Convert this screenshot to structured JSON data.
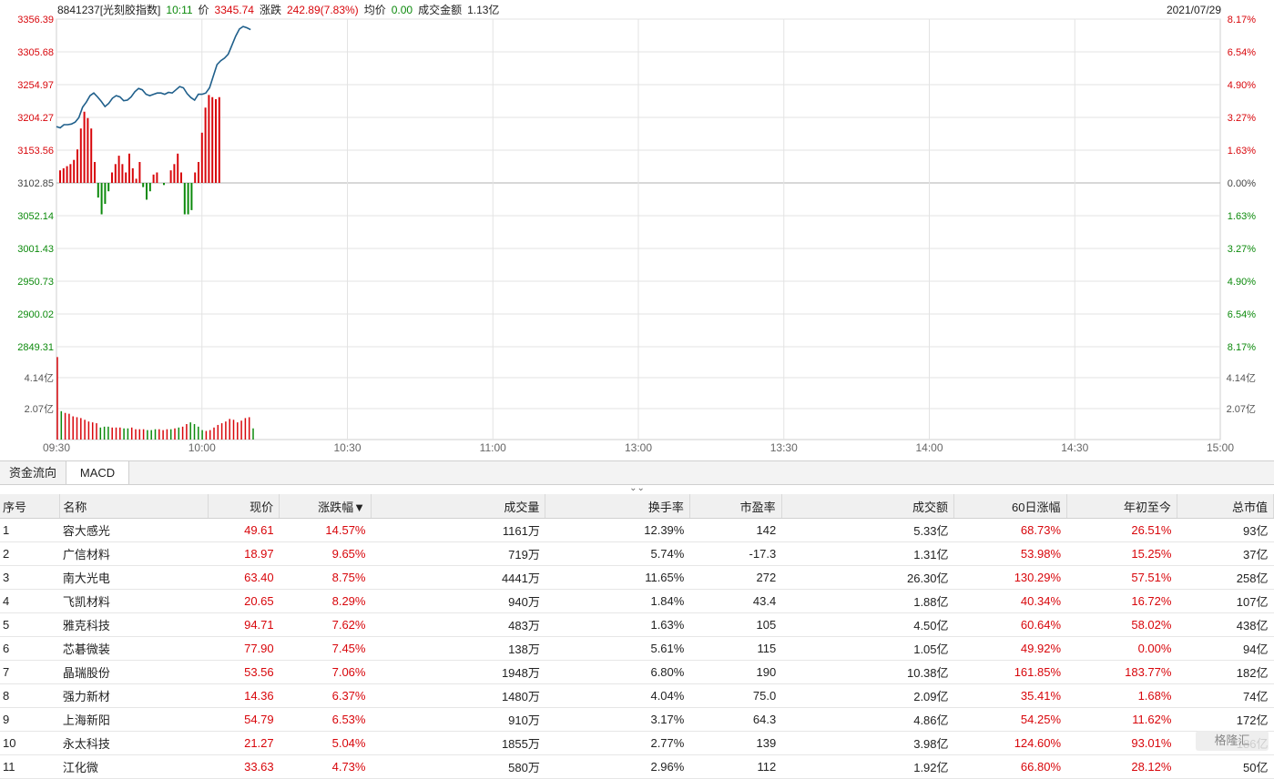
{
  "header": {
    "code_name": "8841237[光刻胶指数]",
    "time": "10:11",
    "price_label": "价",
    "price": "3345.74",
    "change_label": "涨跌",
    "change": "242.89(7.83%)",
    "avg_label": "均价",
    "avg": "0.00",
    "amount_label": "成交金额",
    "amount": "1.13亿",
    "date": "2021/07/29"
  },
  "colors": {
    "up": "#d8060b",
    "down": "#0c8a0c",
    "line": "#1f5f8b",
    "grid": "#e3e3e3"
  },
  "chart_data": {
    "type": "line",
    "xlabel": "",
    "ylabel": "",
    "ylim": [
      2849.31,
      3356.39
    ],
    "base": 3102.85,
    "y_ticks": [
      "3356.39",
      "3305.68",
      "3254.97",
      "3204.27",
      "3153.56",
      "3102.85",
      "3052.14",
      "3001.43",
      "2950.73",
      "2900.02",
      "2849.31"
    ],
    "pct_ticks": [
      "8.17%",
      "6.54%",
      "4.90%",
      "3.27%",
      "1.63%",
      "0.00%",
      "1.63%",
      "3.27%",
      "4.90%",
      "6.54%",
      "8.17%"
    ],
    "x_ticks": [
      "09:30",
      "10:00",
      "10:30",
      "11:00",
      "13:00",
      "13:30",
      "14:00",
      "14:30",
      "15:00"
    ],
    "volume_ticks": [
      "4.14亿",
      "2.07亿"
    ],
    "volume_pct_ticks": [
      "4.14亿",
      "2.07亿"
    ],
    "series": [
      {
        "values": [
          3190,
          3188,
          3193,
          3193,
          3194,
          3197,
          3204,
          3220,
          3228,
          3238,
          3242,
          3236,
          3229,
          3221,
          3226,
          3234,
          3238,
          3236,
          3230,
          3231,
          3236,
          3244,
          3249,
          3247,
          3240,
          3238,
          3240,
          3242,
          3242,
          3240,
          3243,
          3242,
          3247,
          3252,
          3250,
          3241,
          3235,
          3231,
          3240,
          3240,
          3242,
          3250,
          3268,
          3286,
          3292,
          3296,
          3302,
          3316,
          3330,
          3341,
          3345,
          3343,
          3340
        ]
      }
    ],
    "momentum": [
      12,
      14,
      16,
      18,
      22,
      32,
      52,
      68,
      62,
      52,
      20,
      -14,
      -30,
      -20,
      -8,
      10,
      18,
      26,
      18,
      10,
      28,
      14,
      4,
      20,
      -4,
      -16,
      -8,
      8,
      10,
      0,
      -2,
      0,
      12,
      18,
      28,
      10,
      -30,
      -30,
      -26,
      10,
      20,
      48,
      72,
      84,
      82,
      80,
      82
    ],
    "volume": [
      4.8,
      1.65,
      1.55,
      1.5,
      1.35,
      1.3,
      1.25,
      1.15,
      1.05,
      1.0,
      0.95,
      0.7,
      0.75,
      0.75,
      0.7,
      0.7,
      0.7,
      0.65,
      0.65,
      0.7,
      0.6,
      0.6,
      0.6,
      0.55,
      0.55,
      0.6,
      0.6,
      0.55,
      0.6,
      0.6,
      0.65,
      0.7,
      0.75,
      0.9,
      1.0,
      0.9,
      0.75,
      0.55,
      0.5,
      0.55,
      0.7,
      0.85,
      0.95,
      1.05,
      1.2,
      1.15,
      1.0,
      1.1,
      1.25,
      1.3,
      0.65
    ]
  },
  "tabs": [
    "资金流向",
    "MACD"
  ],
  "table": {
    "headers": [
      "序号",
      "名称",
      "现价",
      "涨跌幅▼",
      "成交量",
      "换手率",
      "市盈率",
      "成交额",
      "60日涨幅",
      "年初至今",
      "总市值"
    ],
    "rows": [
      [
        "1",
        "容大感光",
        "49.61",
        "14.57%",
        "1161万",
        "12.39%",
        "142",
        "5.33亿",
        "68.73%",
        "26.51%",
        "93亿"
      ],
      [
        "2",
        "广信材料",
        "18.97",
        "9.65%",
        "719万",
        "5.74%",
        "-17.3",
        "1.31亿",
        "53.98%",
        "15.25%",
        "37亿"
      ],
      [
        "3",
        "南大光电",
        "63.40",
        "8.75%",
        "4441万",
        "11.65%",
        "272",
        "26.30亿",
        "130.29%",
        "57.51%",
        "258亿"
      ],
      [
        "4",
        "飞凯材料",
        "20.65",
        "8.29%",
        "940万",
        "1.84%",
        "43.4",
        "1.88亿",
        "40.34%",
        "16.72%",
        "107亿"
      ],
      [
        "5",
        "雅克科技",
        "94.71",
        "7.62%",
        "483万",
        "1.63%",
        "105",
        "4.50亿",
        "60.64%",
        "58.02%",
        "438亿"
      ],
      [
        "6",
        "芯碁微装",
        "77.90",
        "7.45%",
        "138万",
        "5.61%",
        "115",
        "1.05亿",
        "49.92%",
        "0.00%",
        "94亿"
      ],
      [
        "7",
        "晶瑞股份",
        "53.56",
        "7.06%",
        "1948万",
        "6.80%",
        "190",
        "10.38亿",
        "161.85%",
        "183.77%",
        "182亿"
      ],
      [
        "8",
        "强力新材",
        "14.36",
        "6.37%",
        "1480万",
        "4.04%",
        "75.0",
        "2.09亿",
        "35.41%",
        "1.68%",
        "74亿"
      ],
      [
        "9",
        "上海新阳",
        "54.79",
        "6.53%",
        "910万",
        "3.17%",
        "64.3",
        "4.86亿",
        "54.25%",
        "11.62%",
        "172亿"
      ],
      [
        "10",
        "永太科技",
        "21.27",
        "5.04%",
        "1855万",
        "2.77%",
        "139",
        "3.98亿",
        "124.60%",
        "93.01%",
        "186亿"
      ],
      [
        "11",
        "江化微",
        "33.63",
        "4.73%",
        "580万",
        "2.96%",
        "112",
        "1.92亿",
        "66.80%",
        "28.12%",
        "50亿"
      ]
    ]
  },
  "collapse_icon": "chevron-double-down-icon",
  "watermark": "格隆汇"
}
